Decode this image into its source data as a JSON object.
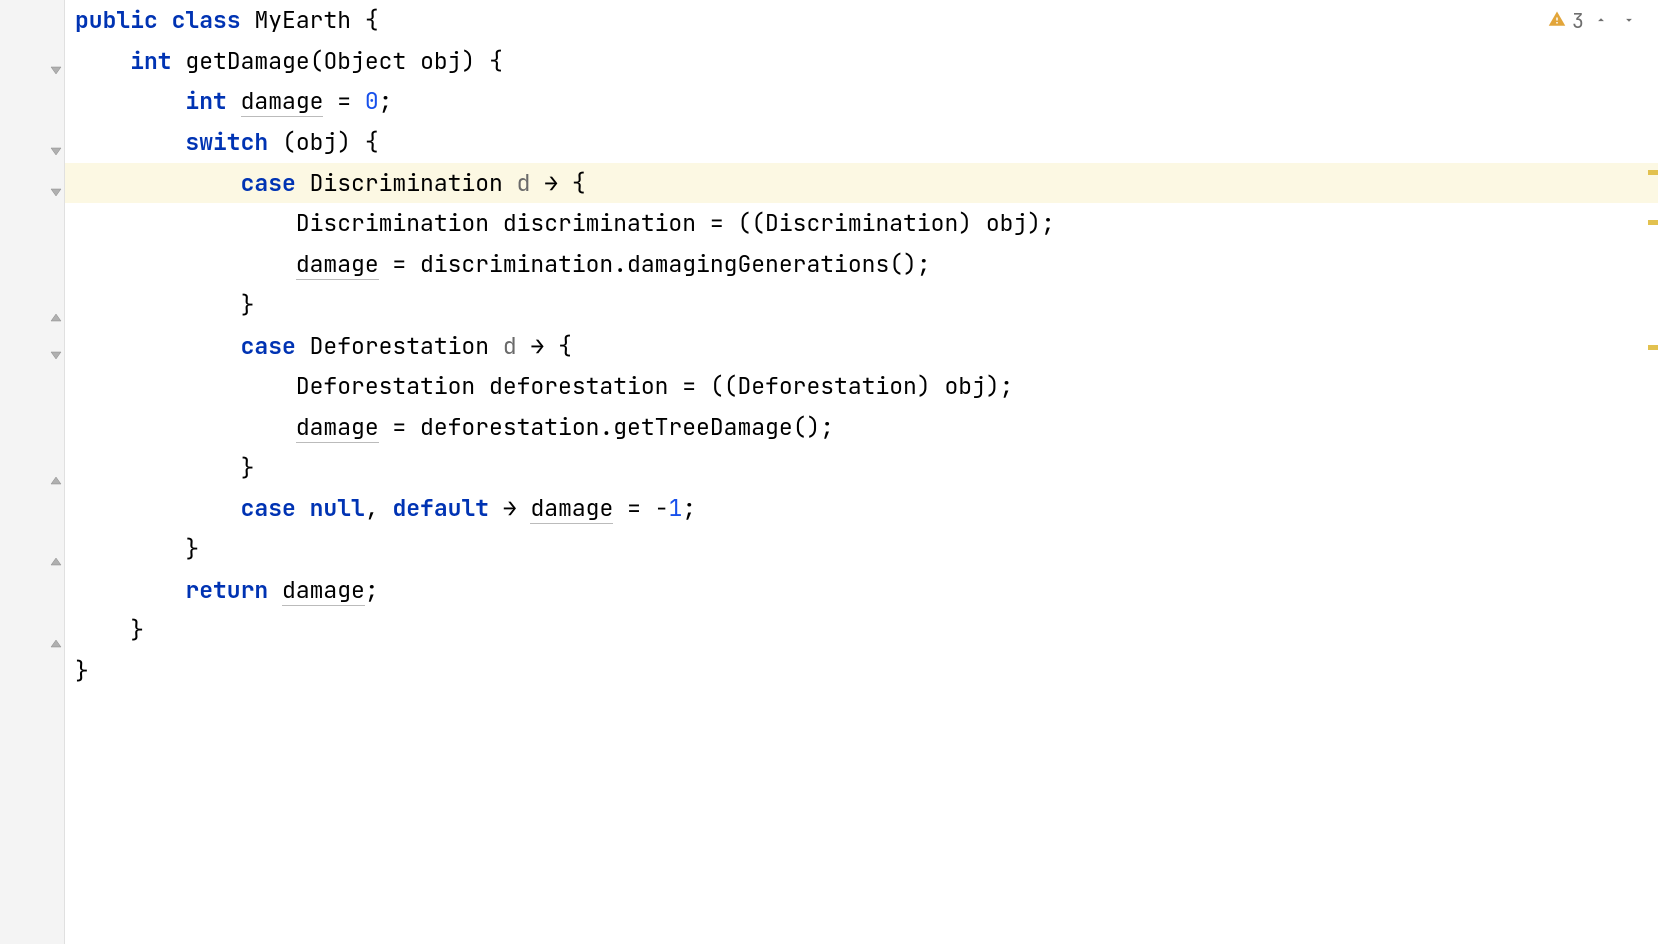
{
  "inspections": {
    "warning_count": "3"
  },
  "code": {
    "lines": [
      {
        "indent": 0,
        "tokens": [
          {
            "t": "public",
            "c": "kw"
          },
          {
            "t": " "
          },
          {
            "t": "class",
            "c": "kw"
          },
          {
            "t": " "
          },
          {
            "t": "MyEarth",
            "c": "type"
          },
          {
            "t": " {"
          }
        ]
      },
      {
        "indent": 1,
        "tokens": [
          {
            "t": "int",
            "c": "kw"
          },
          {
            "t": " "
          },
          {
            "t": "getDamage",
            "c": "method"
          },
          {
            "t": "("
          },
          {
            "t": "Object",
            "c": "type"
          },
          {
            "t": " "
          },
          {
            "t": "obj",
            "c": "varname"
          },
          {
            "t": ") {"
          }
        ]
      },
      {
        "indent": 2,
        "tokens": [
          {
            "t": "int",
            "c": "kw"
          },
          {
            "t": " "
          },
          {
            "t": "damage",
            "c": "underline"
          },
          {
            "t": " = "
          },
          {
            "t": "0",
            "c": "num"
          },
          {
            "t": ";"
          }
        ]
      },
      {
        "indent": 2,
        "tokens": [
          {
            "t": "switch",
            "c": "kw"
          },
          {
            "t": " ("
          },
          {
            "t": "obj",
            "c": "varname"
          },
          {
            "t": ") {"
          }
        ]
      },
      {
        "indent": 3,
        "highlight": true,
        "tokens": [
          {
            "t": "case",
            "c": "kw"
          },
          {
            "t": " "
          },
          {
            "t": "Discrimination",
            "c": "type"
          },
          {
            "t": " "
          },
          {
            "t": "d",
            "c": "param"
          },
          {
            "t": " "
          },
          {
            "t": "→",
            "c": "arrow"
          },
          {
            "t": " {"
          }
        ]
      },
      {
        "indent": 4,
        "tokens": [
          {
            "t": "Discrimination",
            "c": "type"
          },
          {
            "t": " "
          },
          {
            "t": "discrimination",
            "c": "varname"
          },
          {
            "t": " = (("
          },
          {
            "t": "Discrimination",
            "c": "type"
          },
          {
            "t": ") "
          },
          {
            "t": "obj",
            "c": "varname"
          },
          {
            "t": ");"
          }
        ]
      },
      {
        "indent": 4,
        "tokens": [
          {
            "t": "damage",
            "c": "underline"
          },
          {
            "t": " = "
          },
          {
            "t": "discrimination",
            "c": "varname"
          },
          {
            "t": "."
          },
          {
            "t": "damagingGenerations",
            "c": "method"
          },
          {
            "t": "();"
          }
        ]
      },
      {
        "indent": 3,
        "tokens": [
          {
            "t": "}"
          }
        ]
      },
      {
        "indent": 3,
        "tokens": [
          {
            "t": "case",
            "c": "kw"
          },
          {
            "t": " "
          },
          {
            "t": "Deforestation",
            "c": "type"
          },
          {
            "t": " "
          },
          {
            "t": "d",
            "c": "param"
          },
          {
            "t": " "
          },
          {
            "t": "→",
            "c": "arrow"
          },
          {
            "t": " {"
          }
        ]
      },
      {
        "indent": 4,
        "tokens": [
          {
            "t": "Deforestation",
            "c": "type"
          },
          {
            "t": " "
          },
          {
            "t": "deforestation",
            "c": "varname"
          },
          {
            "t": " = (("
          },
          {
            "t": "Deforestation",
            "c": "type"
          },
          {
            "t": ") "
          },
          {
            "t": "obj",
            "c": "varname"
          },
          {
            "t": ");"
          }
        ]
      },
      {
        "indent": 4,
        "tokens": [
          {
            "t": "damage",
            "c": "underline"
          },
          {
            "t": " = "
          },
          {
            "t": "deforestation",
            "c": "varname"
          },
          {
            "t": "."
          },
          {
            "t": "getTreeDamage",
            "c": "method"
          },
          {
            "t": "();"
          }
        ]
      },
      {
        "indent": 3,
        "tokens": [
          {
            "t": "}"
          }
        ]
      },
      {
        "indent": 3,
        "tokens": [
          {
            "t": "case",
            "c": "kw"
          },
          {
            "t": " "
          },
          {
            "t": "null",
            "c": "kw"
          },
          {
            "t": ", "
          },
          {
            "t": "default",
            "c": "kw"
          },
          {
            "t": " "
          },
          {
            "t": "→",
            "c": "arrow"
          },
          {
            "t": " "
          },
          {
            "t": "damage",
            "c": "underline"
          },
          {
            "t": " = -"
          },
          {
            "t": "1",
            "c": "num"
          },
          {
            "t": ";"
          }
        ]
      },
      {
        "indent": 2,
        "tokens": [
          {
            "t": "}"
          }
        ]
      },
      {
        "indent": 2,
        "tokens": [
          {
            "t": "return",
            "c": "kw"
          },
          {
            "t": " "
          },
          {
            "t": "damage",
            "c": "underline"
          },
          {
            "t": ";"
          }
        ]
      },
      {
        "indent": 1,
        "tokens": [
          {
            "t": "}"
          }
        ]
      },
      {
        "indent": 0,
        "tokens": [
          {
            "t": "}"
          }
        ]
      }
    ]
  },
  "fold_markers": [
    {
      "line": 1,
      "type": "open"
    },
    {
      "line": 3,
      "type": "open"
    },
    {
      "line": 4,
      "type": "open"
    },
    {
      "line": 7,
      "type": "close"
    },
    {
      "line": 8,
      "type": "open"
    },
    {
      "line": 11,
      "type": "close"
    },
    {
      "line": 13,
      "type": "close"
    },
    {
      "line": 15,
      "type": "close"
    }
  ],
  "ruler_marks": [
    170,
    220,
    345
  ]
}
